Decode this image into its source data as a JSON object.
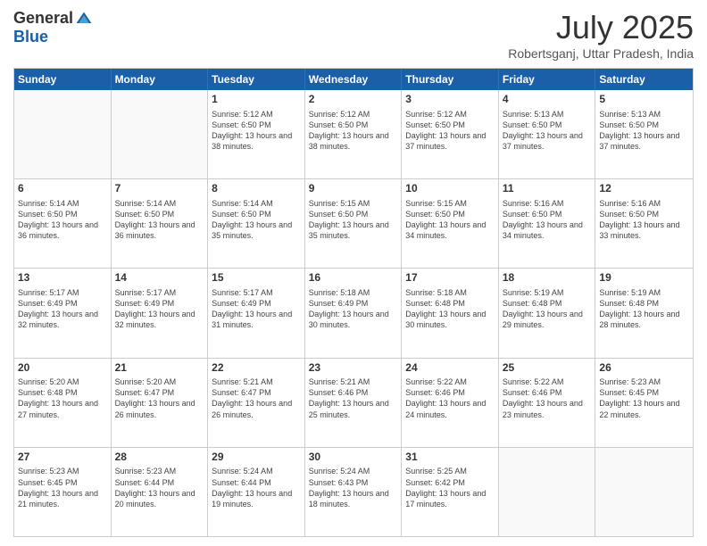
{
  "logo": {
    "general": "General",
    "blue": "Blue"
  },
  "header": {
    "month_year": "July 2025",
    "location": "Robertsganj, Uttar Pradesh, India"
  },
  "days_of_week": [
    "Sunday",
    "Monday",
    "Tuesday",
    "Wednesday",
    "Thursday",
    "Friday",
    "Saturday"
  ],
  "weeks": [
    [
      {
        "day": "",
        "info": ""
      },
      {
        "day": "",
        "info": ""
      },
      {
        "day": "1",
        "info": "Sunrise: 5:12 AM\nSunset: 6:50 PM\nDaylight: 13 hours and 38 minutes."
      },
      {
        "day": "2",
        "info": "Sunrise: 5:12 AM\nSunset: 6:50 PM\nDaylight: 13 hours and 38 minutes."
      },
      {
        "day": "3",
        "info": "Sunrise: 5:12 AM\nSunset: 6:50 PM\nDaylight: 13 hours and 37 minutes."
      },
      {
        "day": "4",
        "info": "Sunrise: 5:13 AM\nSunset: 6:50 PM\nDaylight: 13 hours and 37 minutes."
      },
      {
        "day": "5",
        "info": "Sunrise: 5:13 AM\nSunset: 6:50 PM\nDaylight: 13 hours and 37 minutes."
      }
    ],
    [
      {
        "day": "6",
        "info": "Sunrise: 5:14 AM\nSunset: 6:50 PM\nDaylight: 13 hours and 36 minutes."
      },
      {
        "day": "7",
        "info": "Sunrise: 5:14 AM\nSunset: 6:50 PM\nDaylight: 13 hours and 36 minutes."
      },
      {
        "day": "8",
        "info": "Sunrise: 5:14 AM\nSunset: 6:50 PM\nDaylight: 13 hours and 35 minutes."
      },
      {
        "day": "9",
        "info": "Sunrise: 5:15 AM\nSunset: 6:50 PM\nDaylight: 13 hours and 35 minutes."
      },
      {
        "day": "10",
        "info": "Sunrise: 5:15 AM\nSunset: 6:50 PM\nDaylight: 13 hours and 34 minutes."
      },
      {
        "day": "11",
        "info": "Sunrise: 5:16 AM\nSunset: 6:50 PM\nDaylight: 13 hours and 34 minutes."
      },
      {
        "day": "12",
        "info": "Sunrise: 5:16 AM\nSunset: 6:50 PM\nDaylight: 13 hours and 33 minutes."
      }
    ],
    [
      {
        "day": "13",
        "info": "Sunrise: 5:17 AM\nSunset: 6:49 PM\nDaylight: 13 hours and 32 minutes."
      },
      {
        "day": "14",
        "info": "Sunrise: 5:17 AM\nSunset: 6:49 PM\nDaylight: 13 hours and 32 minutes."
      },
      {
        "day": "15",
        "info": "Sunrise: 5:17 AM\nSunset: 6:49 PM\nDaylight: 13 hours and 31 minutes."
      },
      {
        "day": "16",
        "info": "Sunrise: 5:18 AM\nSunset: 6:49 PM\nDaylight: 13 hours and 30 minutes."
      },
      {
        "day": "17",
        "info": "Sunrise: 5:18 AM\nSunset: 6:48 PM\nDaylight: 13 hours and 30 minutes."
      },
      {
        "day": "18",
        "info": "Sunrise: 5:19 AM\nSunset: 6:48 PM\nDaylight: 13 hours and 29 minutes."
      },
      {
        "day": "19",
        "info": "Sunrise: 5:19 AM\nSunset: 6:48 PM\nDaylight: 13 hours and 28 minutes."
      }
    ],
    [
      {
        "day": "20",
        "info": "Sunrise: 5:20 AM\nSunset: 6:48 PM\nDaylight: 13 hours and 27 minutes."
      },
      {
        "day": "21",
        "info": "Sunrise: 5:20 AM\nSunset: 6:47 PM\nDaylight: 13 hours and 26 minutes."
      },
      {
        "day": "22",
        "info": "Sunrise: 5:21 AM\nSunset: 6:47 PM\nDaylight: 13 hours and 26 minutes."
      },
      {
        "day": "23",
        "info": "Sunrise: 5:21 AM\nSunset: 6:46 PM\nDaylight: 13 hours and 25 minutes."
      },
      {
        "day": "24",
        "info": "Sunrise: 5:22 AM\nSunset: 6:46 PM\nDaylight: 13 hours and 24 minutes."
      },
      {
        "day": "25",
        "info": "Sunrise: 5:22 AM\nSunset: 6:46 PM\nDaylight: 13 hours and 23 minutes."
      },
      {
        "day": "26",
        "info": "Sunrise: 5:23 AM\nSunset: 6:45 PM\nDaylight: 13 hours and 22 minutes."
      }
    ],
    [
      {
        "day": "27",
        "info": "Sunrise: 5:23 AM\nSunset: 6:45 PM\nDaylight: 13 hours and 21 minutes."
      },
      {
        "day": "28",
        "info": "Sunrise: 5:23 AM\nSunset: 6:44 PM\nDaylight: 13 hours and 20 minutes."
      },
      {
        "day": "29",
        "info": "Sunrise: 5:24 AM\nSunset: 6:44 PM\nDaylight: 13 hours and 19 minutes."
      },
      {
        "day": "30",
        "info": "Sunrise: 5:24 AM\nSunset: 6:43 PM\nDaylight: 13 hours and 18 minutes."
      },
      {
        "day": "31",
        "info": "Sunrise: 5:25 AM\nSunset: 6:42 PM\nDaylight: 13 hours and 17 minutes."
      },
      {
        "day": "",
        "info": ""
      },
      {
        "day": "",
        "info": ""
      }
    ]
  ]
}
